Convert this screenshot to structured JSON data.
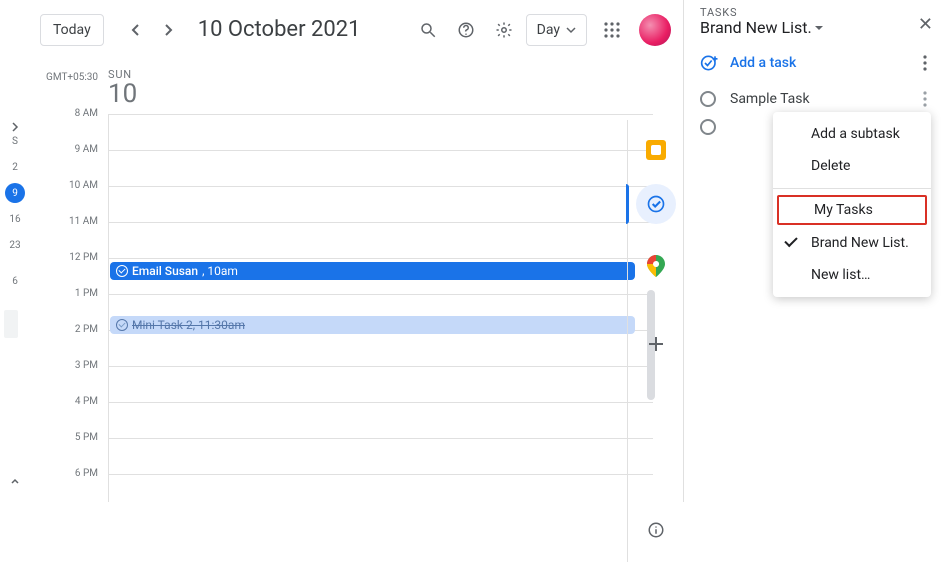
{
  "header": {
    "today_label": "Today",
    "date_title": "10 October 2021",
    "view_label": "Day"
  },
  "timezone": "GMT+05:30",
  "mini_dates": [
    "S",
    "2",
    "9",
    "16",
    "23",
    "6"
  ],
  "day": {
    "dow": "SUN",
    "num": "10"
  },
  "hours": [
    "8 AM",
    "9 AM",
    "10 AM",
    "11 AM",
    "12 PM",
    "1 PM",
    "2 PM",
    "3 PM",
    "4 PM",
    "5 PM",
    "6 PM"
  ],
  "events": {
    "e1_title": "Email Susan",
    "e1_time": ", 10am",
    "e2_title": "Mini Task 2, 11:30am"
  },
  "tasks": {
    "caption": "TASKS",
    "list_name": "Brand New List.",
    "add_label": "Add a task",
    "task1": "Sample Task"
  },
  "menu": {
    "sub": "Add a subtask",
    "del": "Delete",
    "mytasks": "My Tasks",
    "current": "Brand New List.",
    "newlist": "New list…"
  }
}
